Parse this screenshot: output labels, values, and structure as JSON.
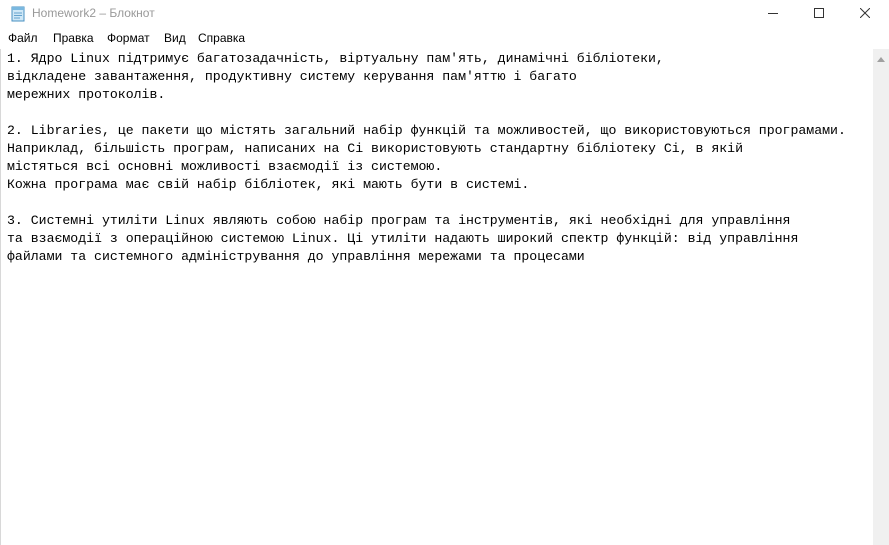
{
  "window": {
    "title": "Homework2 – Блокнот",
    "icon": "notepad-icon",
    "controls": [
      "minimize-icon",
      "maximize-icon",
      "close-icon"
    ]
  },
  "menu": {
    "items": [
      {
        "label": "Файл"
      },
      {
        "label": "Правка"
      },
      {
        "label": "Формат"
      },
      {
        "label": "Вид"
      },
      {
        "label": "Справка"
      }
    ]
  },
  "document": {
    "lines": [
      "1. Ядро Linux підтримує багатозадачність, віртуальну пам'ять, динамічні бібліотеки,",
      "відкладене завантаження, продуктивну систему керування пам'яттю і багато",
      "мережних протоколів.",
      "",
      "2. Libraries, це пакети що містять загальний набір функцій та можливостей, що використовуються програмами.",
      "Наприклад, більшість програм, написаних на Сі використовують стандартну бібліотеку Сі, в якій",
      "містяться всі основні можливості взаємодії із системою.",
      "Кожна програма має свій набір бібліотек, які мають бути в системі.",
      "",
      "3. Системні утиліти Linux являють собою набір програм та інструментів, які необхідні для управління",
      "та взаємодії з операційною системою Linux. Ці утиліти надають широкий спектр функцій: від управління",
      "файлами та системного адміністрування до управління мережами та процесами"
    ]
  }
}
